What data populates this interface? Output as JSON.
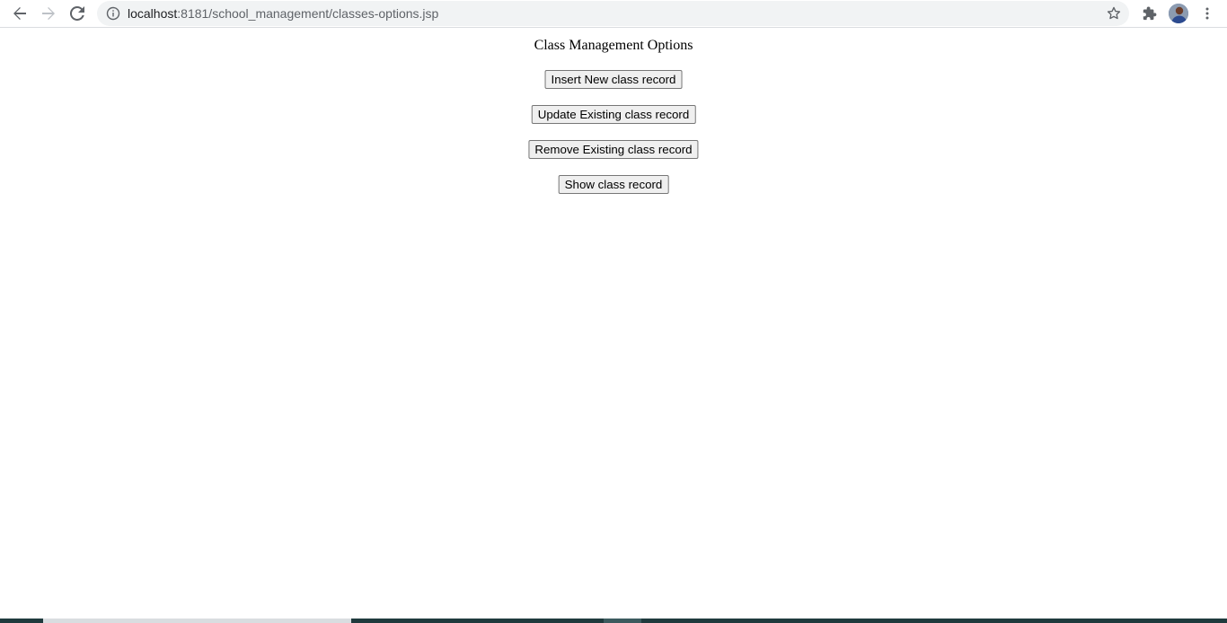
{
  "browser": {
    "url_host": "localhost",
    "url_path": ":8181/school_management/classes-options.jsp"
  },
  "page": {
    "title": "Class Management Options",
    "buttons": [
      "Insert New class record",
      "Update Existing class record",
      "Remove Existing class record",
      "Show class record"
    ]
  },
  "icons": {
    "back": "back-arrow-icon",
    "forward": "forward-arrow-icon",
    "reload": "reload-icon",
    "info": "info-icon",
    "star": "star-icon",
    "extensions": "puzzle-icon",
    "profile": "avatar",
    "menu": "kebab-menu-icon"
  },
  "colors": {
    "button_bg": "#efefef",
    "button_border": "#767676",
    "omnibox_bg": "#f1f3f4"
  }
}
